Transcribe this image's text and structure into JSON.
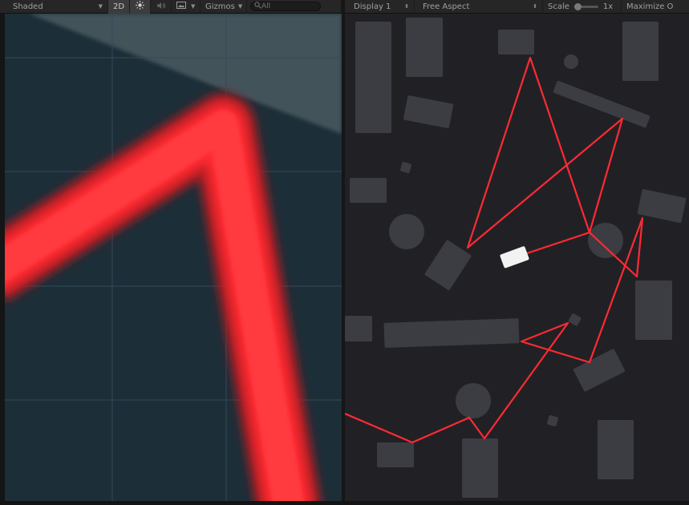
{
  "scene_toolbar": {
    "shading_mode": "Shaded",
    "mode_2d": "2D",
    "lighting_icon": "sun-icon",
    "audio_icon": "speaker-icon",
    "effects_icon": "image-icon",
    "gizmos": "Gizmos",
    "search_placeholder": "All"
  },
  "game_toolbar": {
    "display": "Display 1",
    "aspect": "Free Aspect",
    "scale_label": "Scale",
    "scale_value": "1x",
    "maximize": "Maximize O"
  },
  "colors": {
    "scene_bg": "#1c2e38",
    "game_bg": "#212125",
    "laser": "#ff2a33",
    "obstacle": "#3c3d43"
  }
}
